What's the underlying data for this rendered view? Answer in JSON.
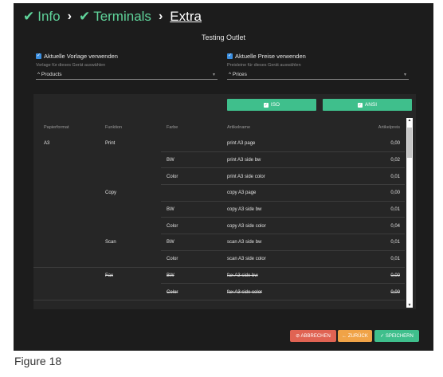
{
  "breadcrumb": {
    "items": [
      {
        "label": "Info",
        "state": "done"
      },
      {
        "label": "Terminals",
        "state": "done"
      },
      {
        "label": "Extra",
        "state": "current"
      }
    ],
    "separator": "›"
  },
  "outlet_title": "Testing Outlet",
  "template_option": {
    "label": "Aktuelle Vorlage verwenden",
    "checked": true,
    "hint": "Vorlage für dieses Gerät auswählen",
    "selected": "^ Products"
  },
  "price_option": {
    "label": "Aktuelle Preise verwenden",
    "checked": true,
    "hint": "Preisleine für dieses Gerät auswählen",
    "selected": "^ Prices"
  },
  "filters": {
    "iso": {
      "label": "ISO",
      "checked": true
    },
    "ansi": {
      "label": "ANSI",
      "checked": true
    }
  },
  "table": {
    "headers": {
      "paper": "Papierformat",
      "function": "Funktion",
      "color": "Farbe",
      "article": "Artikelname",
      "price": "Artikelpreis"
    },
    "rows": [
      {
        "paper": "A3",
        "function": "Print",
        "color": "",
        "article": "print A3 page",
        "price": "0,00",
        "disabled": false
      },
      {
        "paper": "",
        "function": "",
        "color": "BW",
        "article": "print A3 side bw",
        "price": "0,02",
        "disabled": false
      },
      {
        "paper": "",
        "function": "",
        "color": "Color",
        "article": "print A3 side color",
        "price": "0,01",
        "disabled": false
      },
      {
        "paper": "",
        "function": "Copy",
        "color": "",
        "article": "copy A3 page",
        "price": "0,00",
        "disabled": false
      },
      {
        "paper": "",
        "function": "",
        "color": "BW",
        "article": "copy A3 side bw",
        "price": "0,01",
        "disabled": false
      },
      {
        "paper": "",
        "function": "",
        "color": "Color",
        "article": "copy A3 side color",
        "price": "0,04",
        "disabled": false
      },
      {
        "paper": "",
        "function": "Scan",
        "color": "BW",
        "article": "scan A3 side bw",
        "price": "0,01",
        "disabled": false
      },
      {
        "paper": "",
        "function": "",
        "color": "Color",
        "article": "scan A3 side color",
        "price": "0,01",
        "disabled": false
      },
      {
        "paper": "",
        "function": "Fax",
        "color": "BW",
        "article": "fax A3 side bw",
        "price": "0,00",
        "disabled": true
      },
      {
        "paper": "",
        "function": "",
        "color": "Color",
        "article": "fax A3 side color",
        "price": "0,00",
        "disabled": true
      }
    ]
  },
  "actions": {
    "cancel": "⊘ ABBRECHEN",
    "back": "← ZURÜCK",
    "save": "✓ SPEICHERN"
  },
  "caption": "Figure 18",
  "colors": {
    "accent": "#3fbf8c",
    "breadcrumb": "#5fd39a",
    "cancel": "#e06353",
    "back": "#f0a347",
    "background": "#1c1c1c"
  }
}
